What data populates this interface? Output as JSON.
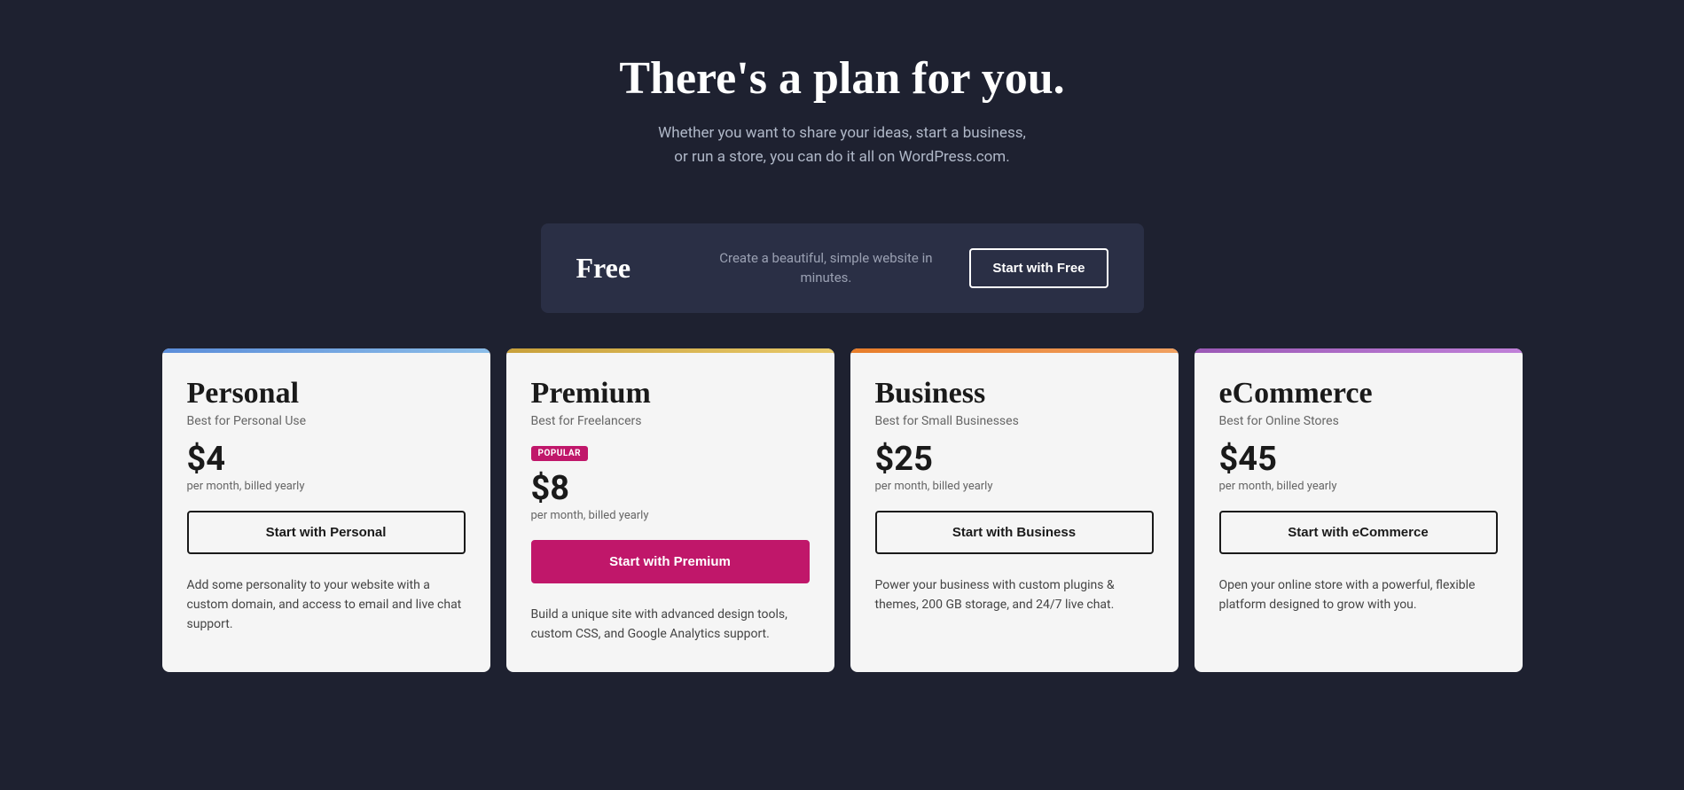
{
  "hero": {
    "title": "There's a plan for you.",
    "subtitle_line1": "Whether you want to share your ideas, start a business,",
    "subtitle_line2": "or run a store, you can do it all on WordPress.com."
  },
  "free_plan": {
    "name": "Free",
    "description": "Create a beautiful, simple website in minutes.",
    "cta": "Start with Free"
  },
  "plans": [
    {
      "id": "personal",
      "title": "Personal",
      "subtitle": "Best for Personal Use",
      "popular": false,
      "price": "$4",
      "billing": "per month, billed yearly",
      "cta": "Start with Personal",
      "description": "Add some personality to your website with a custom domain, and access to email and live chat support."
    },
    {
      "id": "premium",
      "title": "Premium",
      "subtitle": "Best for Freelancers",
      "popular": true,
      "popular_label": "POPULAR",
      "price": "$8",
      "billing": "per month, billed yearly",
      "cta": "Start with Premium",
      "description": "Build a unique site with advanced design tools, custom CSS, and Google Analytics support."
    },
    {
      "id": "business",
      "title": "Business",
      "subtitle": "Best for Small Businesses",
      "popular": false,
      "price": "$25",
      "billing": "per month, billed yearly",
      "cta": "Start with Business",
      "description": "Power your business with custom plugins & themes, 200 GB storage, and 24/7 live chat."
    },
    {
      "id": "ecommerce",
      "title": "eCommerce",
      "subtitle": "Best for Online Stores",
      "popular": false,
      "price": "$45",
      "billing": "per month, billed yearly",
      "cta": "Start with eCommerce",
      "description": "Open your online store with a powerful, flexible platform designed to grow with you."
    }
  ]
}
